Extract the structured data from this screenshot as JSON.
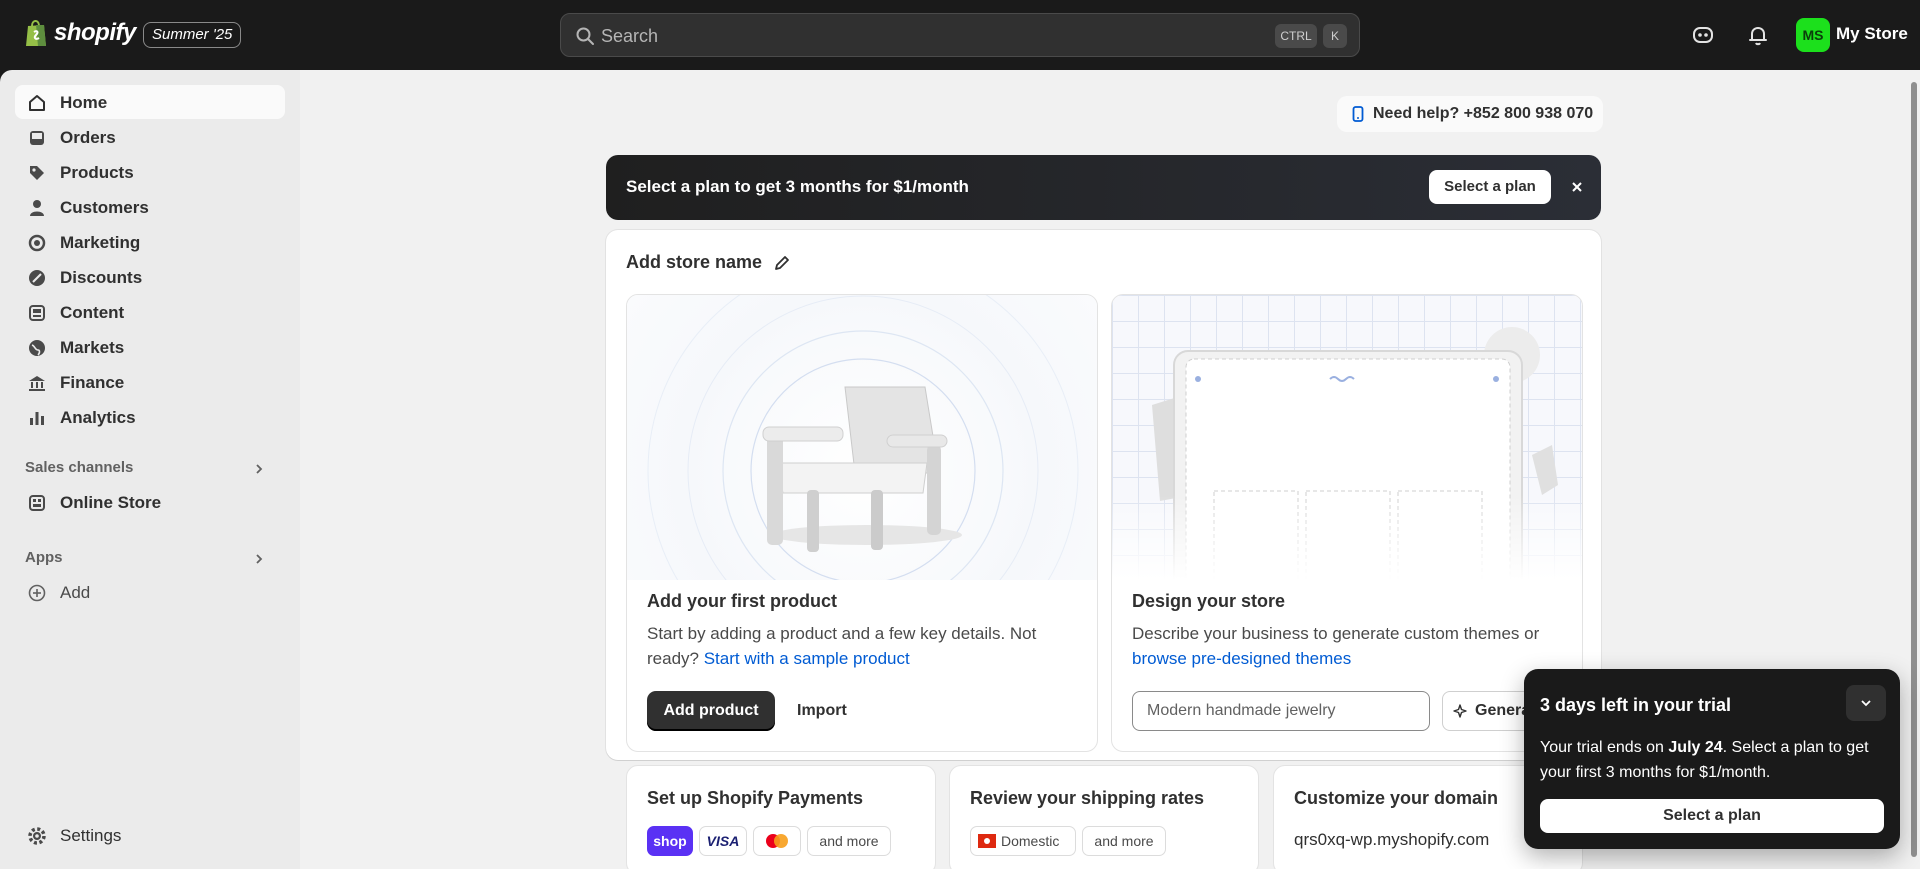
{
  "topbar": {
    "logo_text": "shopify",
    "edition": "Summer '25",
    "search_placeholder": "Search",
    "shortcut_ctrl": "CTRL",
    "shortcut_k": "K",
    "avatar_initials": "MS",
    "store_name": "My Store",
    "avatar_color": "#1ce01c"
  },
  "sidebar": {
    "items": [
      {
        "label": "Home",
        "icon": "home-icon",
        "active": true
      },
      {
        "label": "Orders",
        "icon": "inbox-icon"
      },
      {
        "label": "Products",
        "icon": "tag-icon"
      },
      {
        "label": "Customers",
        "icon": "person-icon"
      },
      {
        "label": "Marketing",
        "icon": "target-icon"
      },
      {
        "label": "Discounts",
        "icon": "discount-icon"
      },
      {
        "label": "Content",
        "icon": "image-icon"
      },
      {
        "label": "Markets",
        "icon": "globe-icon"
      },
      {
        "label": "Finance",
        "icon": "bank-icon"
      },
      {
        "label": "Analytics",
        "icon": "bar-chart-icon"
      }
    ],
    "sales_channels_label": "Sales channels",
    "online_store_label": "Online Store",
    "apps_label": "Apps",
    "add_label": "Add",
    "settings_label": "Settings"
  },
  "help": {
    "text": "Need help? +852 800 938 070"
  },
  "banner": {
    "text": "Select a plan to get 3 months for $1/month",
    "button": "Select a plan"
  },
  "setup": {
    "title": "Add store name",
    "product": {
      "title": "Add your first product",
      "desc": "Start by adding a product and a few key details. Not ready?",
      "link": "Start with a sample product",
      "primary": "Add product",
      "secondary": "Import"
    },
    "design": {
      "title": "Design your store",
      "desc": "Describe your business to generate custom themes or",
      "link": "browse pre-designed themes",
      "input_value": "Modern handmade jewelry",
      "generate": "Generate"
    }
  },
  "tasks": [
    {
      "title": "Set up Shopify Payments",
      "pills": [
        "shop",
        "VISA",
        "and more"
      ]
    },
    {
      "title": "Review your shipping rates",
      "pills": [
        "Domestic",
        "and more"
      ]
    },
    {
      "title": "Customize your domain",
      "text": "qrs0xq-wp.myshopify.com"
    }
  ],
  "trial": {
    "title": "3 days left in your trial",
    "body_prefix": "Your trial ends on ",
    "body_date": "July 24",
    "body_suffix": ". Select a plan to get your first 3 months for $1/month.",
    "button": "Select a plan"
  }
}
